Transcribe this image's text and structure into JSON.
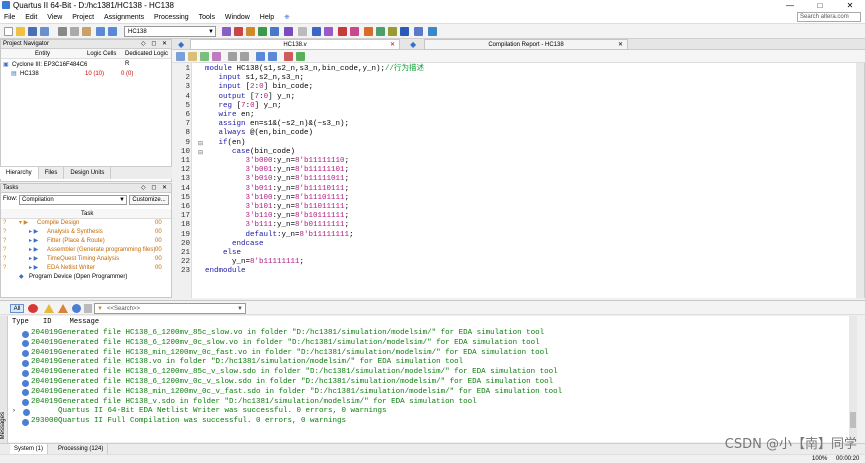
{
  "window": {
    "title": "Quartus II 64-Bit - D:/hc1381/HC138 - HC138",
    "controls": [
      "—",
      "□",
      "✕"
    ]
  },
  "menu": [
    "File",
    "Edit",
    "View",
    "Project",
    "Assignments",
    "Processing",
    "Tools",
    "Window",
    "Help"
  ],
  "search": {
    "placeholder": "Search altera.com"
  },
  "toolbar": {
    "entity_combo": "HC138"
  },
  "project_navigator": {
    "title": "Project Navigator",
    "columns": [
      "Entity",
      "Logic Cells",
      "Dedicated Logic R"
    ],
    "rows": [
      {
        "name": "Cyclone III: EP3C16F484C6",
        "logic": "",
        "dedicated": ""
      },
      {
        "name": "HC138",
        "logic": "10 (10)",
        "dedicated": "0 (0)"
      }
    ],
    "tabs": [
      "Hierarchy",
      "Files",
      "Design Units"
    ]
  },
  "tasks": {
    "title": "Tasks",
    "flow_label": "Flow:",
    "flow_value": "Compilation",
    "customize": "Customize...",
    "column": "Task",
    "items": [
      {
        "mark": "?",
        "label": "Compile Design",
        "level": 0,
        "time": "00"
      },
      {
        "mark": "?",
        "label": "Analysis & Synthesis",
        "level": 1,
        "time": "00"
      },
      {
        "mark": "?",
        "label": "Fitter (Place & Route)",
        "level": 1,
        "time": "00"
      },
      {
        "mark": "?",
        "label": "Assembler (Generate programming files)",
        "level": 1,
        "time": "00"
      },
      {
        "mark": "?",
        "label": "TimeQuest Timing Analysis",
        "level": 1,
        "time": "00"
      },
      {
        "mark": "?",
        "label": "EDA Netlist Writer",
        "level": 1,
        "time": "00"
      },
      {
        "mark": "",
        "label": "Program Device (Open Programmer)",
        "level": 0,
        "time": ""
      }
    ]
  },
  "editor_tabs": [
    {
      "label": "HC138.v",
      "close": "✕"
    },
    {
      "label": "Compilation Report - HC138",
      "close": "✕"
    }
  ],
  "code_lines": [
    {
      "n": "1",
      "parts": [
        [
          "kw",
          "module "
        ],
        [
          "plain",
          "HC138(s1,s2_n,s3_n,bin_code,y_n);"
        ],
        [
          "cm",
          "//行为描述"
        ]
      ]
    },
    {
      "n": "2",
      "parts": [
        [
          "plain",
          "   "
        ],
        [
          "kw",
          "input "
        ],
        [
          "plain",
          "s1,s2_n,s3_n;"
        ]
      ]
    },
    {
      "n": "3",
      "parts": [
        [
          "plain",
          "   "
        ],
        [
          "kw",
          "input "
        ],
        [
          "plain",
          "["
        ],
        [
          "num",
          "2"
        ],
        [
          "plain",
          ":"
        ],
        [
          "num",
          "0"
        ],
        [
          "plain",
          "] bin_code;"
        ]
      ]
    },
    {
      "n": "4",
      "parts": [
        [
          "plain",
          "   "
        ],
        [
          "kw",
          "output "
        ],
        [
          "plain",
          "["
        ],
        [
          "num",
          "7"
        ],
        [
          "plain",
          ":"
        ],
        [
          "num",
          "0"
        ],
        [
          "plain",
          "] y_n;"
        ]
      ]
    },
    {
      "n": "5",
      "parts": [
        [
          "plain",
          "   "
        ],
        [
          "kw",
          "reg "
        ],
        [
          "plain",
          "["
        ],
        [
          "num",
          "7"
        ],
        [
          "plain",
          ":"
        ],
        [
          "num",
          "0"
        ],
        [
          "plain",
          "] y_n;"
        ]
      ]
    },
    {
      "n": "6",
      "parts": [
        [
          "plain",
          "   "
        ],
        [
          "kw",
          "wire "
        ],
        [
          "plain",
          "en;"
        ]
      ]
    },
    {
      "n": "7",
      "parts": [
        [
          "plain",
          "   "
        ],
        [
          "kw",
          "assign "
        ],
        [
          "plain",
          "en=s1&(~s2_n)&(~s3_n);"
        ]
      ]
    },
    {
      "n": "8",
      "parts": [
        [
          "plain",
          "   "
        ],
        [
          "kw",
          "always "
        ],
        [
          "plain",
          "@(en,bin_code)"
        ]
      ]
    },
    {
      "n": "9",
      "parts": [
        [
          "plain",
          "   "
        ],
        [
          "kw",
          "if"
        ],
        [
          "plain",
          "(en)"
        ]
      ]
    },
    {
      "n": "10",
      "parts": [
        [
          "plain",
          "      "
        ],
        [
          "kw",
          "case"
        ],
        [
          "plain",
          "(bin_code)"
        ]
      ]
    },
    {
      "n": "11",
      "parts": [
        [
          "plain",
          "         "
        ],
        [
          "num",
          "3'b000"
        ],
        [
          "plain",
          ":y_n="
        ],
        [
          "num",
          "8'b11111110"
        ],
        [
          "plain",
          ";"
        ]
      ]
    },
    {
      "n": "12",
      "parts": [
        [
          "plain",
          "         "
        ],
        [
          "num",
          "3'b001"
        ],
        [
          "plain",
          ":y_n="
        ],
        [
          "num",
          "8'b11111101"
        ],
        [
          "plain",
          ";"
        ]
      ]
    },
    {
      "n": "13",
      "parts": [
        [
          "plain",
          "         "
        ],
        [
          "num",
          "3'b010"
        ],
        [
          "plain",
          ":y_n="
        ],
        [
          "num",
          "8'b11111011"
        ],
        [
          "plain",
          ";"
        ]
      ]
    },
    {
      "n": "14",
      "parts": [
        [
          "plain",
          "         "
        ],
        [
          "num",
          "3'b011"
        ],
        [
          "plain",
          ":y_n="
        ],
        [
          "num",
          "8'b11110111"
        ],
        [
          "plain",
          ";"
        ]
      ]
    },
    {
      "n": "15",
      "parts": [
        [
          "plain",
          "         "
        ],
        [
          "num",
          "3'b100"
        ],
        [
          "plain",
          ":y_n="
        ],
        [
          "num",
          "8'b11101111"
        ],
        [
          "plain",
          ";"
        ]
      ]
    },
    {
      "n": "16",
      "parts": [
        [
          "plain",
          "         "
        ],
        [
          "num",
          "3'b101"
        ],
        [
          "plain",
          ":y_n="
        ],
        [
          "num",
          "8'b11011111"
        ],
        [
          "plain",
          ";"
        ]
      ]
    },
    {
      "n": "17",
      "parts": [
        [
          "plain",
          "         "
        ],
        [
          "num",
          "3'b110"
        ],
        [
          "plain",
          ":y_n="
        ],
        [
          "num",
          "8'b10111111"
        ],
        [
          "plain",
          ";"
        ]
      ]
    },
    {
      "n": "18",
      "parts": [
        [
          "plain",
          "         "
        ],
        [
          "num",
          "3'b111"
        ],
        [
          "plain",
          ":y_n="
        ],
        [
          "num",
          "8'b01111111"
        ],
        [
          "plain",
          ";"
        ]
      ]
    },
    {
      "n": "19",
      "parts": [
        [
          "plain",
          "         "
        ],
        [
          "kw",
          "default"
        ],
        [
          "plain",
          ":y_n="
        ],
        [
          "num",
          "8'b11111111"
        ],
        [
          "plain",
          ";"
        ]
      ]
    },
    {
      "n": "20",
      "parts": [
        [
          "plain",
          "      "
        ],
        [
          "kw",
          "endcase"
        ]
      ]
    },
    {
      "n": "21",
      "parts": [
        [
          "plain",
          "    "
        ],
        [
          "kw",
          "else"
        ]
      ]
    },
    {
      "n": "22",
      "parts": [
        [
          "plain",
          "      y_n="
        ],
        [
          "num",
          "8'b11111111"
        ],
        [
          "plain",
          ";"
        ]
      ]
    },
    {
      "n": "23",
      "parts": [
        [
          "kw",
          "endmodule"
        ]
      ]
    }
  ],
  "messages_toolbar": {
    "all": "All",
    "search_placeholder": "<<Search>>"
  },
  "messages_header": [
    "Type",
    "ID",
    "Message"
  ],
  "messages": [
    {
      "id": "204019",
      "text": "Generated file HC138_6_1200mv_85c_slow.vo in folder \"D:/hc1381/simulation/modelsim/\" for EDA simulation tool",
      "expand": false
    },
    {
      "id": "204019",
      "text": "Generated file HC138_6_1200mv_0c_slow.vo in folder \"D:/hc1381/simulation/modelsim/\" for EDA simulation tool",
      "expand": false
    },
    {
      "id": "204019",
      "text": "Generated file HC138_min_1200mv_0c_fast.vo in folder \"D:/hc1381/simulation/modelsim/\" for EDA simulation tool",
      "expand": false
    },
    {
      "id": "204019",
      "text": "Generated file HC138.vo in folder \"D:/hc1381/simulation/modelsim/\" for EDA simulation tool",
      "expand": false
    },
    {
      "id": "204019",
      "text": "Generated file HC138_6_1200mv_85c_v_slow.sdo in folder \"D:/hc1381/simulation/modelsim/\" for EDA simulation tool",
      "expand": false
    },
    {
      "id": "204019",
      "text": "Generated file HC138_6_1200mv_0c_v_slow.sdo in folder \"D:/hc1381/simulation/modelsim/\" for EDA simulation tool",
      "expand": false
    },
    {
      "id": "204019",
      "text": "Generated file HC138_min_1200mv_0c_v_fast.sdo in folder \"D:/hc1381/simulation/modelsim/\" for EDA simulation tool",
      "expand": false
    },
    {
      "id": "204019",
      "text": "Generated file HC138_v.sdo in folder \"D:/hc1381/simulation/modelsim/\" for EDA simulation tool",
      "expand": false
    },
    {
      "id": "",
      "text": "      Quartus II 64-Bit EDA Netlist Writer was successful. 0 errors, 0 warnings",
      "expand": true
    },
    {
      "id": "293000",
      "text": "Quartus II Full Compilation was successful. 0 errors, 0 warnings",
      "expand": false
    }
  ],
  "bottom_tabs": [
    "System (1)",
    "Processing (124)"
  ],
  "side_tab": "Messages",
  "status": {
    "zoom": "100%",
    "time": "00:00:20"
  },
  "watermark": "CSDN @小【南】同学",
  "colors": {
    "keyword": "#1a1aa6",
    "number": "#b21c84",
    "comment": "#11a03a",
    "message": "#0a7d0a"
  }
}
